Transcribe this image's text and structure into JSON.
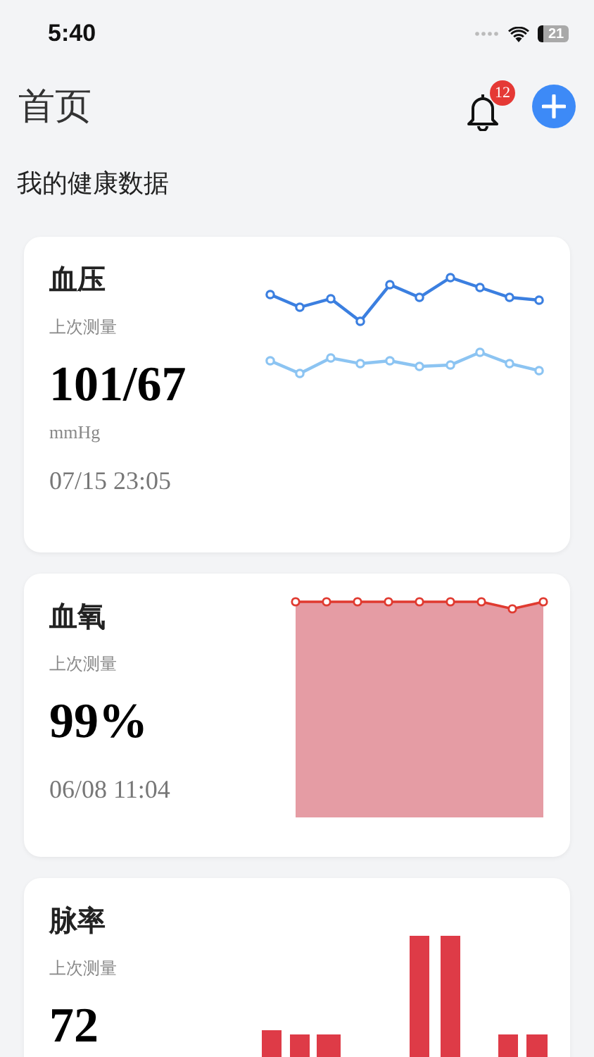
{
  "status_bar": {
    "time": "5:40",
    "battery": "21"
  },
  "header": {
    "title": "首页",
    "notification_count": "12"
  },
  "section_title": "我的健康数据",
  "cards": [
    {
      "kind": "line",
      "title": "血压",
      "subtitle": "上次测量",
      "value": "101/67",
      "unit": "mmHg",
      "time": "07/15 23:05"
    },
    {
      "kind": "area",
      "title": "血氧",
      "subtitle": "上次测量",
      "value": "99%",
      "time": "06/08 11:04"
    },
    {
      "kind": "bar",
      "title": "脉率",
      "subtitle": "上次测量",
      "value": "72"
    }
  ]
}
